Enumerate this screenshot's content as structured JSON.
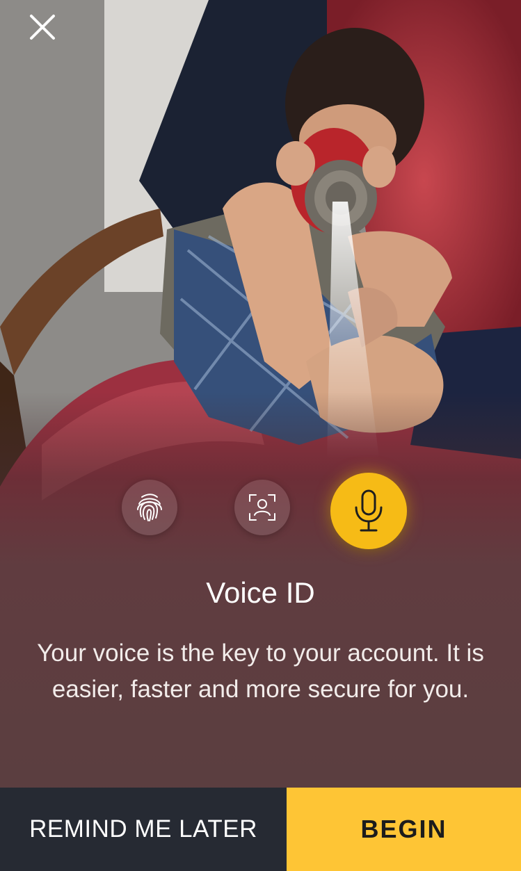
{
  "header": {
    "close_icon": "close-icon"
  },
  "auth_methods": [
    {
      "icon": "fingerprint-icon",
      "selected": false
    },
    {
      "icon": "face-scan-icon",
      "selected": false
    },
    {
      "icon": "microphone-icon",
      "selected": true
    }
  ],
  "content": {
    "title": "Voice ID",
    "description": "Your voice is the key to your account. It is easier, faster and more secure for you."
  },
  "actions": {
    "remind_label": "REMIND ME LATER",
    "begin_label": "BEGIN"
  },
  "colors": {
    "accent": "#f6bb16",
    "begin_button": "#fec535",
    "remind_button": "#262a33"
  }
}
